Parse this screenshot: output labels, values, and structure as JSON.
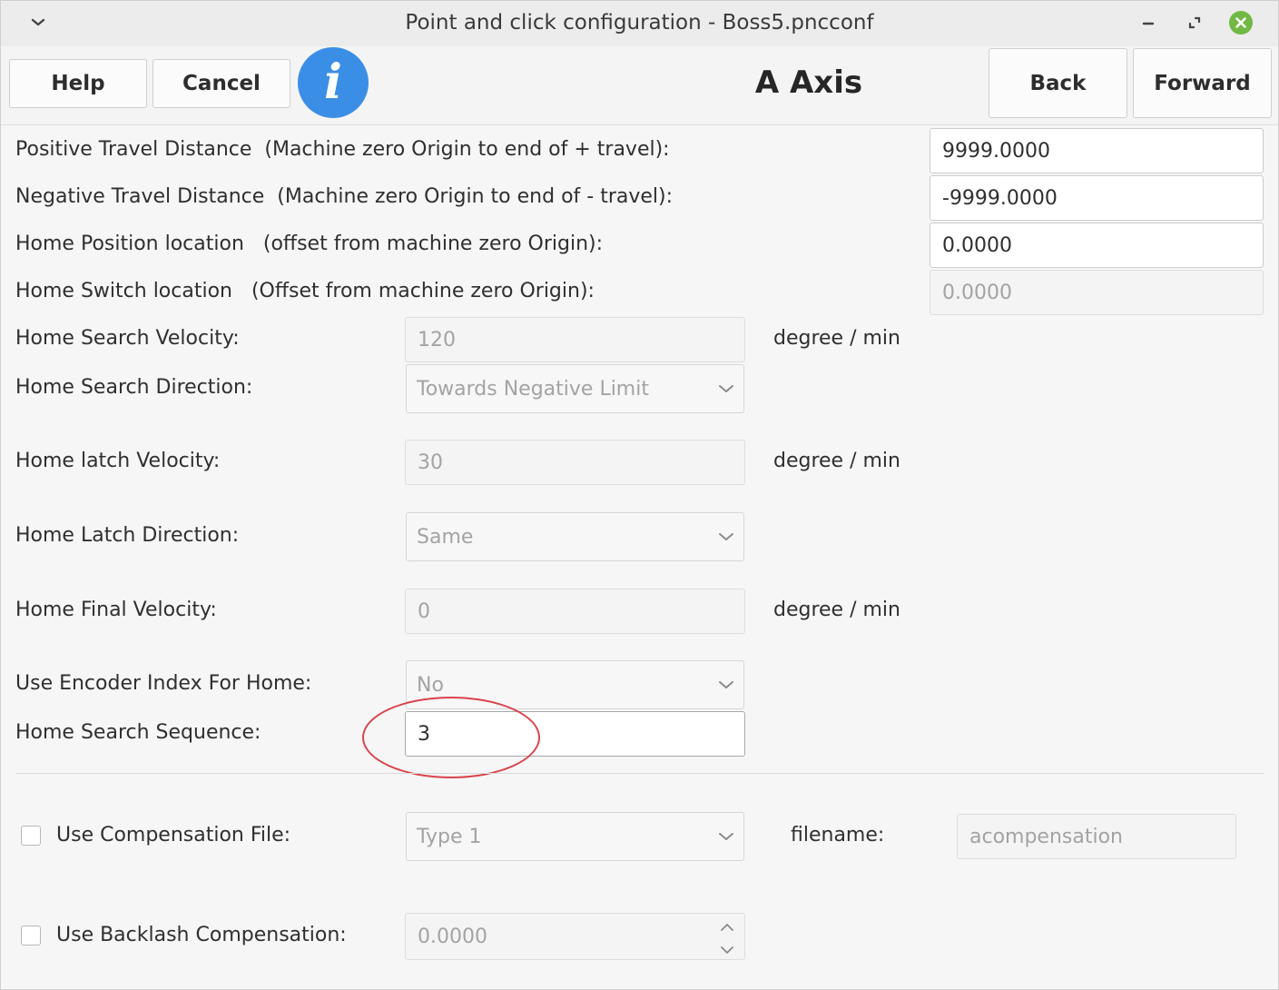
{
  "window": {
    "title": "Point and click configuration - Boss5.pncconf"
  },
  "toolbar": {
    "help_label": "Help",
    "cancel_label": "Cancel",
    "info_glyph": "i",
    "page_title": "A Axis",
    "back_label": "Back",
    "forward_label": "Forward"
  },
  "form": {
    "positive_travel": {
      "label": "Positive Travel Distance  (Machine zero Origin to end of + travel):",
      "value": "9999.0000"
    },
    "negative_travel": {
      "label": "Negative Travel Distance  (Machine zero Origin to end of - travel):",
      "value": "-9999.0000"
    },
    "home_position": {
      "label": "Home Position location   (offset from machine zero Origin):",
      "value": "0.0000"
    },
    "home_switch": {
      "label": "Home Switch location   (Offset from machine zero Origin):",
      "value": "0.0000"
    },
    "home_search_velocity": {
      "label": "Home Search Velocity:",
      "value": "120",
      "unit": "degree / min"
    },
    "home_search_direction": {
      "label": "Home Search Direction:",
      "value": "Towards Negative Limit"
    },
    "home_latch_velocity": {
      "label": "Home latch Velocity:",
      "value": "30",
      "unit": "degree / min"
    },
    "home_latch_direction": {
      "label": "Home Latch Direction:",
      "value": "Same"
    },
    "home_final_velocity": {
      "label": "Home Final Velocity:",
      "value": "0",
      "unit": "degree / min"
    },
    "use_encoder_index": {
      "label": "Use Encoder Index For Home:",
      "value": "No"
    },
    "home_search_sequence": {
      "label": "Home Search Sequence:",
      "value": "3"
    }
  },
  "compensation": {
    "use_comp_file": {
      "label": "Use Compensation File:",
      "checked": false,
      "type_value": "Type 1",
      "filename_label": "filename:",
      "filename_value": "acompensation"
    },
    "use_backlash": {
      "label": "Use Backlash Compensation:",
      "checked": false,
      "value": "0.0000"
    }
  },
  "colors": {
    "accent": "#3b8ee6",
    "highlight": "#d9434b",
    "close_button": "#72b845"
  },
  "icons": {
    "window_menu": "chevron-down-icon",
    "minimize": "minimize-icon",
    "maximize": "maximize-icon",
    "close": "close-icon",
    "info": "info-icon"
  }
}
